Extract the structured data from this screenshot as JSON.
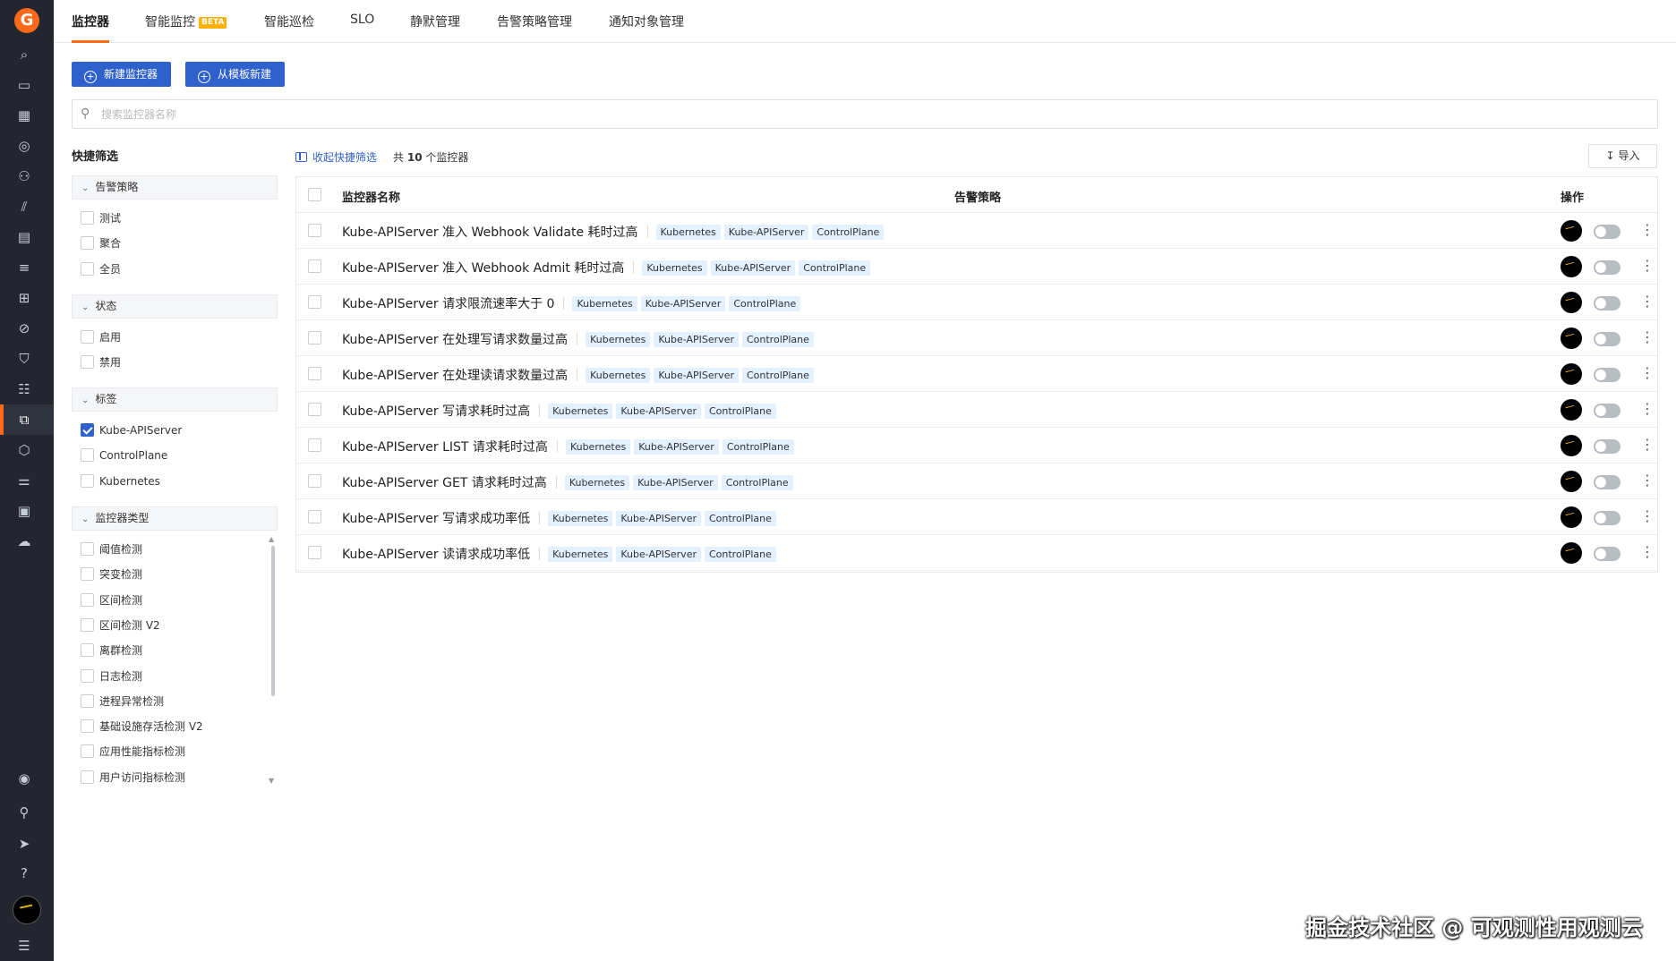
{
  "app": {
    "logo_letter": "G",
    "brand_color": "#ff6a1a",
    "accent_color": "#2f61cc"
  },
  "sidebar": {
    "icons": [
      "search-icon",
      "dashboard-icon",
      "calendar-icon",
      "scan-icon",
      "infra-icon",
      "metrics-icon",
      "log-query-icon",
      "list-icon",
      "apps-icon",
      "block-icon",
      "shield-icon",
      "database-icon",
      "monitor-icon",
      "security-icon",
      "settings-sliders-icon",
      "integration-icon",
      "cloud-icon",
      "eye-icon",
      "user-icon",
      "send-icon",
      "help-icon",
      "menu-icon"
    ]
  },
  "tabs": [
    {
      "label": "监控器"
    },
    {
      "label": "智能监控",
      "badge": "BETA"
    },
    {
      "label": "智能巡检"
    },
    {
      "label": "SLO"
    },
    {
      "label": "静默管理"
    },
    {
      "label": "告警策略管理"
    },
    {
      "label": "通知对象管理"
    }
  ],
  "actions": {
    "new_monitor": "新建监控器",
    "from_template": "从模板新建"
  },
  "search": {
    "placeholder": "搜索监控器名称",
    "value": ""
  },
  "filters": {
    "title": "快捷筛选",
    "groups": [
      {
        "label": "告警策略",
        "options": [
          {
            "label": "测试",
            "checked": false
          },
          {
            "label": "聚合",
            "checked": false
          },
          {
            "label": "全员",
            "checked": false
          }
        ]
      },
      {
        "label": "状态",
        "options": [
          {
            "label": "启用",
            "checked": false
          },
          {
            "label": "禁用",
            "checked": false
          }
        ]
      },
      {
        "label": "标签",
        "options": [
          {
            "label": "Kube-APIServer",
            "checked": true
          },
          {
            "label": "ControlPlane",
            "checked": false
          },
          {
            "label": "Kubernetes",
            "checked": false
          }
        ]
      },
      {
        "label": "监控器类型",
        "options": [
          {
            "label": "阈值检测",
            "checked": false
          },
          {
            "label": "突变检测",
            "checked": false
          },
          {
            "label": "区间检测",
            "checked": false
          },
          {
            "label": "区间检测 V2",
            "checked": false
          },
          {
            "label": "离群检测",
            "checked": false
          },
          {
            "label": "日志检测",
            "checked": false
          },
          {
            "label": "进程异常检测",
            "checked": false
          },
          {
            "label": "基础设施存活检测 V2",
            "checked": false
          },
          {
            "label": "应用性能指标检测",
            "checked": false
          },
          {
            "label": "用户访问指标检测",
            "checked": false
          }
        ]
      }
    ]
  },
  "toolbar": {
    "collapse_label": "收起快捷筛选",
    "count_prefix": "共",
    "count": "10",
    "count_suffix": "个监控器",
    "import_label": "导入"
  },
  "table": {
    "headers": {
      "name": "监控器名称",
      "policy": "告警策略",
      "ops": "操作"
    },
    "rows": [
      {
        "name": "Kube-APIServer 准入 Webhook Validate 耗时过高",
        "tags": [
          "Kubernetes",
          "Kube-APIServer",
          "ControlPlane"
        ],
        "enabled": false
      },
      {
        "name": "Kube-APIServer 准入 Webhook Admit 耗时过高",
        "tags": [
          "Kubernetes",
          "Kube-APIServer",
          "ControlPlane"
        ],
        "enabled": false
      },
      {
        "name": "Kube-APIServer 请求限流速率大于 0",
        "tags": [
          "Kubernetes",
          "Kube-APIServer",
          "ControlPlane"
        ],
        "enabled": false
      },
      {
        "name": "Kube-APIServer 在处理写请求数量过高",
        "tags": [
          "Kubernetes",
          "Kube-APIServer",
          "ControlPlane"
        ],
        "enabled": false
      },
      {
        "name": "Kube-APIServer 在处理读请求数量过高",
        "tags": [
          "Kubernetes",
          "Kube-APIServer",
          "ControlPlane"
        ],
        "enabled": false
      },
      {
        "name": "Kube-APIServer 写请求耗时过高",
        "tags": [
          "Kubernetes",
          "Kube-APIServer",
          "ControlPlane"
        ],
        "enabled": false
      },
      {
        "name": "Kube-APIServer LIST 请求耗时过高",
        "tags": [
          "Kubernetes",
          "Kube-APIServer",
          "ControlPlane"
        ],
        "enabled": false
      },
      {
        "name": "Kube-APIServer GET 请求耗时过高",
        "tags": [
          "Kubernetes",
          "Kube-APIServer",
          "ControlPlane"
        ],
        "enabled": false
      },
      {
        "name": "Kube-APIServer 写请求成功率低",
        "tags": [
          "Kubernetes",
          "Kube-APIServer",
          "ControlPlane"
        ],
        "enabled": false
      },
      {
        "name": "Kube-APIServer 读请求成功率低",
        "tags": [
          "Kubernetes",
          "Kube-APIServer",
          "ControlPlane"
        ],
        "enabled": false
      }
    ]
  },
  "watermark": "掘金技术社区 @ 可观测性用观测云"
}
